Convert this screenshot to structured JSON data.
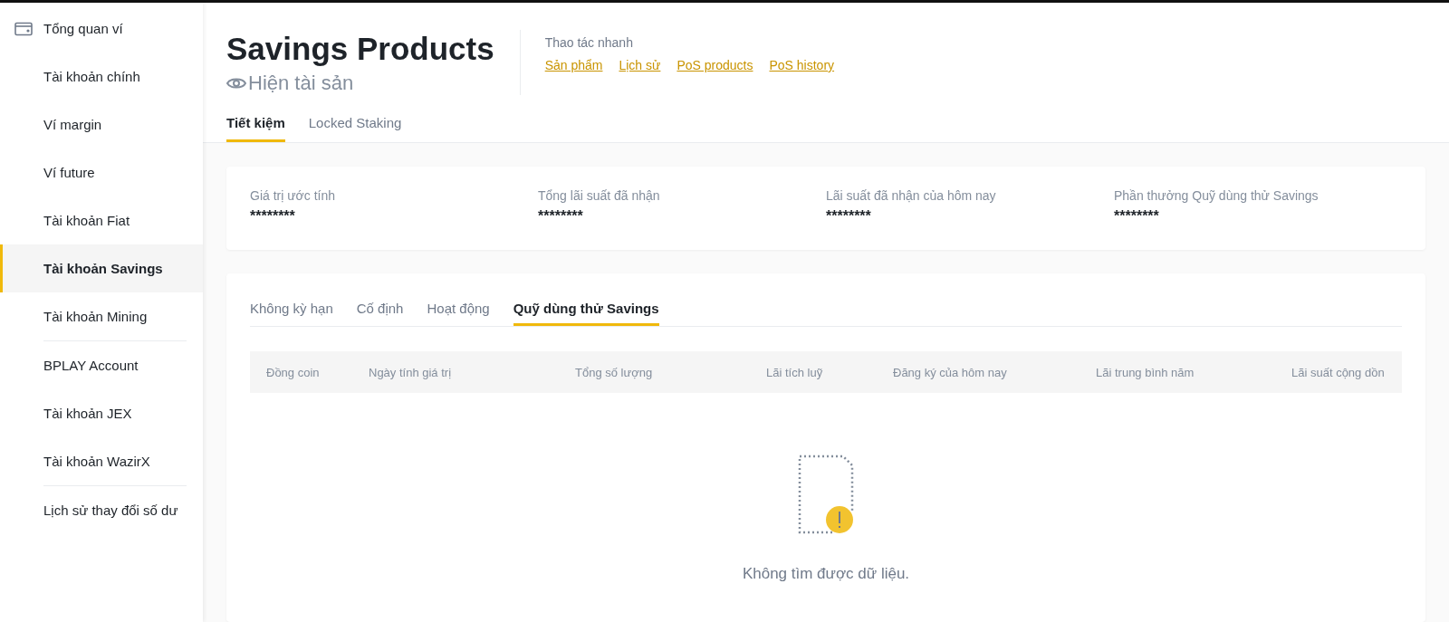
{
  "sidebar": {
    "items": [
      {
        "label": "Tổng quan ví",
        "selected": false,
        "kind": "header"
      },
      {
        "label": "Tài khoản chính",
        "selected": false,
        "kind": "item"
      },
      {
        "label": "Ví margin",
        "selected": false,
        "kind": "item"
      },
      {
        "label": "Ví future",
        "selected": false,
        "kind": "item"
      },
      {
        "label": "Tài khoản Fiat",
        "selected": false,
        "kind": "item"
      },
      {
        "label": "Tài khoản Savings",
        "selected": true,
        "kind": "item"
      },
      {
        "label": "Tài khoản Mining",
        "selected": false,
        "kind": "item"
      },
      {
        "kind": "divider"
      },
      {
        "label": "BPLAY Account",
        "selected": false,
        "kind": "item"
      },
      {
        "label": "Tài khoản JEX",
        "selected": false,
        "kind": "item"
      },
      {
        "label": "Tài khoản WazirX",
        "selected": false,
        "kind": "item"
      },
      {
        "kind": "divider"
      },
      {
        "label": "Lịch sử thay đổi số dư",
        "selected": false,
        "kind": "item"
      }
    ]
  },
  "header": {
    "title": "Savings Products",
    "show_assets": "Hiện tài sản",
    "quick_actions": {
      "label": "Thao tác nhanh",
      "links": [
        "Sản phẩm",
        "Lịch sử",
        "PoS products",
        "PoS history"
      ]
    }
  },
  "tabs": [
    {
      "label": "Tiết kiệm",
      "selected": true
    },
    {
      "label": "Locked Staking",
      "selected": false
    }
  ],
  "summary": [
    {
      "label": "Giá trị ước tính",
      "value": "********"
    },
    {
      "label": "Tổng lãi suất đã nhận",
      "value": "********"
    },
    {
      "label": "Lãi suất đã nhận của hôm nay",
      "value": "********"
    },
    {
      "label": "Phần thưởng Quỹ dùng thử Savings",
      "value": "********"
    }
  ],
  "sub_tabs": [
    {
      "label": "Không kỳ hạn",
      "selected": false
    },
    {
      "label": "Cố định",
      "selected": false
    },
    {
      "label": "Hoạt động",
      "selected": false
    },
    {
      "label": "Quỹ dùng thử Savings",
      "selected": true
    }
  ],
  "table": {
    "columns": [
      "Đồng coin",
      "Ngày tính giá trị",
      "Tổng số lượng",
      "Lãi tích luỹ",
      "Đăng ký của hôm nay",
      "Lãi trung bình năm",
      "Lãi suất cộng dồn"
    ],
    "empty_message": "Không tìm được dữ liệu."
  }
}
